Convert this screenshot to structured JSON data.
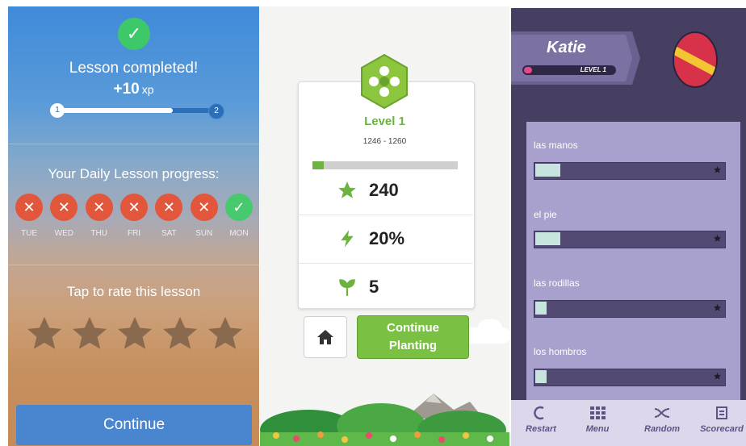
{
  "lesson_panel": {
    "title": "Lesson completed!",
    "xp_value": "+10",
    "xp_unit": "xp",
    "xp_progress": 0.72,
    "xp_start_label": "1",
    "xp_end_label": "2",
    "daily_title": "Your Daily Lesson progress:",
    "days": [
      {
        "label": "TUE",
        "status": "missed",
        "mark": "✕"
      },
      {
        "label": "WED",
        "status": "missed",
        "mark": "✕"
      },
      {
        "label": "THU",
        "status": "missed",
        "mark": "✕"
      },
      {
        "label": "FRI",
        "status": "missed",
        "mark": "✕"
      },
      {
        "label": "SAT",
        "status": "missed",
        "mark": "✕"
      },
      {
        "label": "SUN",
        "status": "missed",
        "mark": "✕"
      },
      {
        "label": "MON",
        "status": "done",
        "mark": "✓"
      }
    ],
    "check_mark": "✓",
    "rate_title": "Tap to rate this lesson",
    "stars_total": 5,
    "stars_selected": 0,
    "continue_label": "Continue",
    "colors": {
      "missed": "#e2573b",
      "done": "#47c96e",
      "button": "#4a86cf"
    }
  },
  "garden_panel": {
    "level_title": "Level 1",
    "level_range": "1246 - 1260",
    "level_progress": 0.08,
    "stats": [
      {
        "icon": "star-icon",
        "value": "240"
      },
      {
        "icon": "lightning-icon",
        "value": "20%"
      },
      {
        "icon": "sprout-icon",
        "value": "5"
      }
    ],
    "home_icon": "home-icon",
    "continue_line1": "Continue",
    "continue_line2": "Planting",
    "accent_color": "#7ac143"
  },
  "vocab_panel": {
    "player_name": "Katie",
    "level_label": "LEVEL 1",
    "words": [
      {
        "text": "las manos",
        "progress": 0.13
      },
      {
        "text": "el pie",
        "progress": 0.13
      },
      {
        "text": "las rodillas",
        "progress": 0.06
      },
      {
        "text": "los hombros",
        "progress": 0.06
      }
    ],
    "toolbar": [
      {
        "label": "Restart",
        "icon": "restart-icon"
      },
      {
        "label": "Menu",
        "icon": "grid-menu-icon"
      },
      {
        "label": "Random",
        "icon": "shuffle-icon"
      },
      {
        "label": "Scorecard",
        "icon": "scorecard-icon"
      }
    ]
  }
}
